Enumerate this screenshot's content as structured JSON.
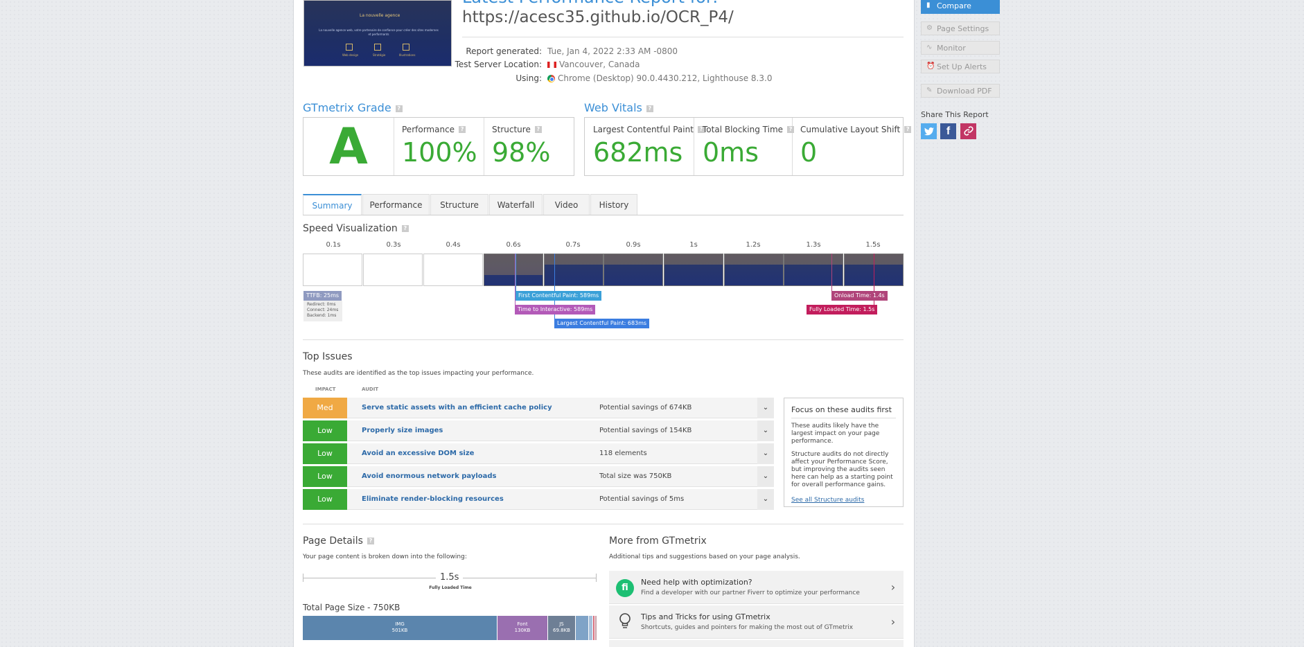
{
  "header": {
    "title_cut": "Latest Performance Report for:",
    "url": "https://acesc35.github.io/OCR_P4/",
    "thumbnail_heading": "La nouvelle agence",
    "thumbnail_text": "La nouvelle agence web, votre partenaire de confiance pour créer des sites modernes et performants",
    "thumbnail_labels": [
      "Web design",
      "Stratégie",
      "Illustrations"
    ]
  },
  "meta": {
    "report_generated_label": "Report generated:",
    "report_generated_value": "Tue, Jan 4, 2022 2:33 AM -0800",
    "server_label": "Test Server Location:",
    "server_value": "Vancouver, Canada",
    "using_label": "Using:",
    "using_value": "Chrome (Desktop) 90.0.4430.212, Lighthouse 8.3.0"
  },
  "grade": {
    "title": "GTmetrix Grade",
    "letter": "A",
    "performance_label": "Performance",
    "performance_value": "100%",
    "structure_label": "Structure",
    "structure_value": "98%"
  },
  "vitals": {
    "title": "Web Vitals",
    "lcp_label": "Largest Contentful Paint",
    "lcp_value": "682ms",
    "tbt_label": "Total Blocking Time",
    "tbt_value": "0ms",
    "cls_label": "Cumulative Layout Shift",
    "cls_value": "0"
  },
  "tabs": [
    "Summary",
    "Performance",
    "Structure",
    "Waterfall",
    "Video",
    "History"
  ],
  "speed": {
    "title": "Speed Visualization",
    "ticks": [
      "0.1s",
      "0.3s",
      "0.4s",
      "0.6s",
      "0.7s",
      "0.9s",
      "1s",
      "1.2s",
      "1.3s",
      "1.5s"
    ],
    "ttfb": "TTFB: 25ms",
    "ttfb_details": [
      "Redirect: 0ms",
      "Connect: 24ms",
      "Backend: 1ms"
    ],
    "fcp": "First Contentful Paint: 589ms",
    "tti": "Time to Interactive: 589ms",
    "lcp": "Largest Contentful Paint: 683ms",
    "onload": "Onload Time: 1.4s",
    "fully_loaded": "Fully Loaded Time: 1.5s",
    "colors": {
      "ttfb": "#8f9ac0",
      "fcp": "#3aa0d8",
      "tti": "#b35ab8",
      "lcp": "#3b7de0",
      "onload": "#b0447a",
      "fully": "#c21d5c"
    }
  },
  "issues": {
    "title": "Top Issues",
    "subtitle": "These audits are identified as the top issues impacting your performance.",
    "col_impact": "IMPACT",
    "col_audit": "AUDIT",
    "rows": [
      {
        "impact": "Med",
        "audit": "Serve static assets with an efficient cache policy",
        "savings": "Potential savings of 674KB"
      },
      {
        "impact": "Low",
        "audit": "Properly size images",
        "savings": "Potential savings of 154KB"
      },
      {
        "impact": "Low",
        "audit": "Avoid an excessive DOM size",
        "savings": "118 elements"
      },
      {
        "impact": "Low",
        "audit": "Avoid enormous network payloads",
        "savings": "Total size was 750KB"
      },
      {
        "impact": "Low",
        "audit": "Eliminate render-blocking resources",
        "savings": "Potential savings of 5ms"
      }
    ],
    "colors": {
      "med": "#f0a944",
      "low": "#3aaa35"
    }
  },
  "focus": {
    "title": "Focus on these audits first",
    "p1": "These audits likely have the largest impact on your page performance.",
    "p2": "Structure audits do not directly affect your Performance Score, but improving the audits seen here can help as a starting point for overall performance gains.",
    "link": "See all Structure audits"
  },
  "sidebar": {
    "compare": "Compare",
    "page_settings": "Page Settings",
    "monitor": "Monitor",
    "alerts": "Set Up Alerts",
    "download": "Download PDF",
    "share_title": "Share This Report"
  },
  "page_details": {
    "title": "Page Details",
    "subtitle": "Your page content is broken down into the following:",
    "fully_loaded_value": "1.5s",
    "fully_loaded_label": "Fully Loaded Time",
    "size_title": "Total Page Size - 750KB",
    "img_label": "IMG",
    "img_value": "501KB",
    "font_label": "Font",
    "font_value": "130KB",
    "js_label": "JS",
    "js_value": "69.8KB"
  },
  "more": {
    "title": "More from GTmetrix",
    "subtitle": "Additional tips and suggestions based on your page analysis.",
    "items": [
      {
        "title": "Need help with optimization?",
        "sub": "Find a developer with our partner Fiverr to optimize your performance"
      },
      {
        "title": "Tips and Tricks for using GTmetrix",
        "sub": "Shortcuts, guides and pointers for making the most out of GTmetrix"
      }
    ]
  }
}
